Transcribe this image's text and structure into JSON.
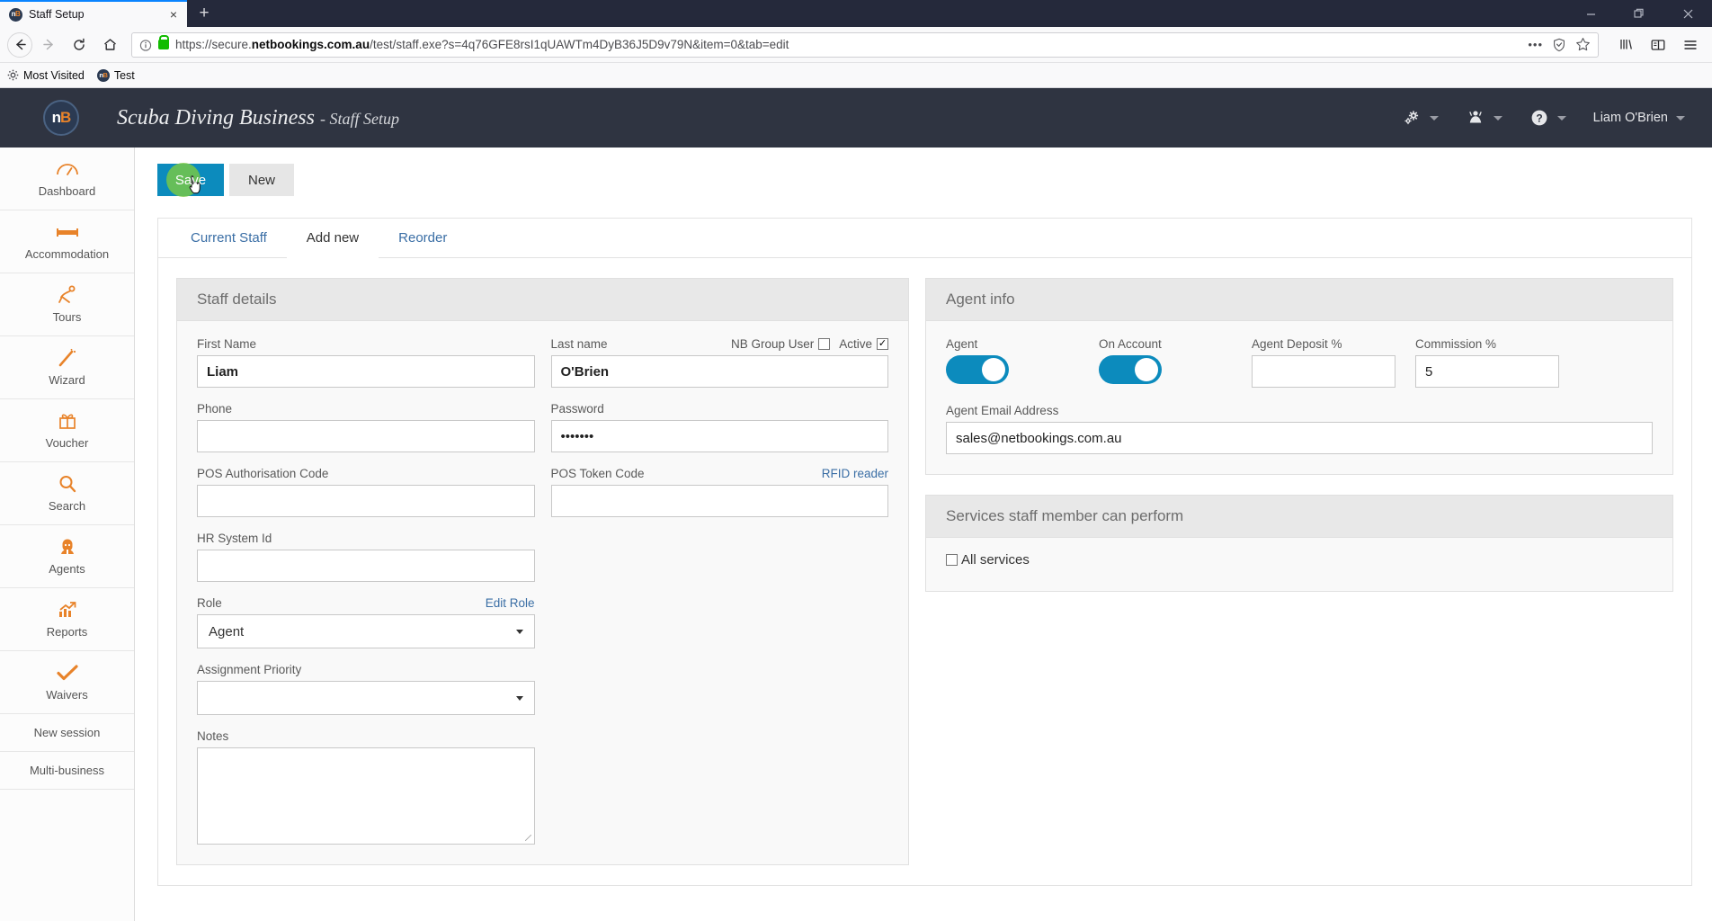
{
  "browser": {
    "tab": {
      "title": "Staff Setup",
      "favicon": "nb-favicon",
      "close": "×"
    },
    "newtab_label": "+",
    "window_controls": {
      "minimize": "—",
      "restore": "❐",
      "close": "✕"
    },
    "nav": {
      "back": "←",
      "forward": "→",
      "reload": "↻",
      "home": "⌂"
    },
    "url": {
      "scheme": "https://secure.",
      "domain": "netbookings.com.au",
      "path": "/test/staff.exe?s=4q76GFE8rsI1qUAWTm4DyB36J5D9v79N&item=0&tab=edit",
      "full": "https://secure.netbookings.com.au/test/staff.exe?s=4q76GFE8rsI1qUAWTm4DyB36J5D9v79N&item=0&tab=edit",
      "security": "secure-lock",
      "info_icon": "page-info-icon"
    },
    "url_actions": {
      "ellipsis": "•••",
      "pocket": "save-to-pocket-icon",
      "bookmark": "star-icon"
    },
    "toolbar": {
      "library": "library-icon",
      "sidebar": "sidebar-icon",
      "menu": "hamburger-menu-icon"
    },
    "bookmarks": [
      {
        "label": "Most Visited",
        "icon": "star-gear-icon"
      },
      {
        "label": "Test",
        "icon": "nb-favicon"
      }
    ]
  },
  "app": {
    "logo": "nb-logo",
    "business_name": "Scuba Diving Business",
    "page_name": "- Staff Setup",
    "header_icons": [
      {
        "name": "settings-gear-icon"
      },
      {
        "name": "user-staff-icon"
      },
      {
        "name": "help-question-icon"
      }
    ],
    "user_name": "Liam O'Brien"
  },
  "sidebar": {
    "items": [
      {
        "label": "Dashboard",
        "icon": "dashboard-icon"
      },
      {
        "label": "Accommodation",
        "icon": "bed-icon"
      },
      {
        "label": "Tours",
        "icon": "tours-icon"
      },
      {
        "label": "Wizard",
        "icon": "magic-wand-icon"
      },
      {
        "label": "Voucher",
        "icon": "gift-icon"
      },
      {
        "label": "Search",
        "icon": "magnifier-icon"
      },
      {
        "label": "Agents",
        "icon": "agent-person-icon"
      },
      {
        "label": "Reports",
        "icon": "chart-growth-icon"
      },
      {
        "label": "Waivers",
        "icon": "checkmark-icon"
      }
    ],
    "links": [
      {
        "label": "New session"
      },
      {
        "label": "Multi-business"
      }
    ]
  },
  "toolbar": {
    "save_label": "Save",
    "new_label": "New"
  },
  "tabs": [
    {
      "label": "Current Staff",
      "active": false
    },
    {
      "label": "Add new",
      "active": true
    },
    {
      "label": "Reorder",
      "active": false
    }
  ],
  "staff_details": {
    "title": "Staff details",
    "first_name": {
      "label": "First Name",
      "value": "Liam"
    },
    "last_name": {
      "label": "Last name",
      "value": "O'Brien"
    },
    "nb_group_user": {
      "label": "NB Group User",
      "checked": false,
      "mark": ""
    },
    "active": {
      "label": "Active",
      "checked": true,
      "mark": "✓"
    },
    "phone": {
      "label": "Phone",
      "value": ""
    },
    "password": {
      "label": "Password",
      "value": "•••••••"
    },
    "pos_auth_code": {
      "label": "POS Authorisation Code",
      "value": ""
    },
    "pos_token_code": {
      "label": "POS Token Code",
      "value": ""
    },
    "rfid_reader_link": "RFID reader",
    "hr_system_id": {
      "label": "HR System Id",
      "value": ""
    },
    "role": {
      "label": "Role",
      "value": "Agent"
    },
    "edit_role_link": "Edit Role",
    "assignment_priority": {
      "label": "Assignment Priority",
      "value": ""
    },
    "notes": {
      "label": "Notes",
      "value": ""
    }
  },
  "agent_info": {
    "title": "Agent info",
    "agent": {
      "label": "Agent",
      "on": true
    },
    "on_account": {
      "label": "On Account",
      "on": true
    },
    "agent_deposit": {
      "label": "Agent Deposit %",
      "value": ""
    },
    "commission": {
      "label": "Commission %",
      "value": "5"
    },
    "agent_email": {
      "label": "Agent Email Address",
      "value": "sales@netbookings.com.au"
    }
  },
  "services": {
    "title": "Services staff member can perform",
    "all_services": {
      "label": "All services",
      "checked": false,
      "mark": ""
    }
  },
  "colors": {
    "accent_orange": "#e8832a",
    "primary_blue": "#0c8bbd",
    "header_dark": "#2f3441",
    "link_blue": "#3a6ea5",
    "click_green": "#7ac943"
  }
}
